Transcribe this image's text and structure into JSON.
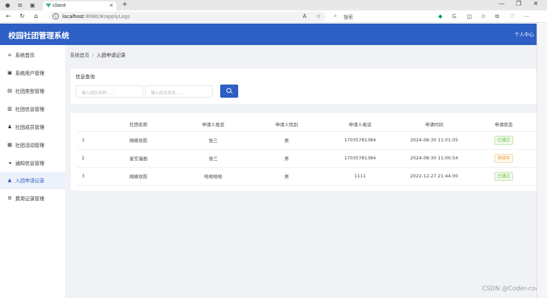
{
  "browser": {
    "tab_title": "client",
    "tab_close": "×",
    "new_tab": "+",
    "url_host": "localhost",
    "url_path": ":8080/#/applyLogs",
    "search_placeholder": "搜索",
    "win_min": "—",
    "win_max": "❐",
    "win_close": "✕"
  },
  "app": {
    "title": "校园社团管理系统",
    "user_menu": "个人中心"
  },
  "sidebar": {
    "items": [
      {
        "label": "系统首页",
        "icon": "home-icon"
      },
      {
        "label": "系统用户管理",
        "icon": "user-admin-icon"
      },
      {
        "label": "社团类型管理",
        "icon": "type-icon"
      },
      {
        "label": "社团信息管理",
        "icon": "info-icon"
      },
      {
        "label": "社团成员管理",
        "icon": "members-icon"
      },
      {
        "label": "社团活动管理",
        "icon": "activity-icon"
      },
      {
        "label": "通知信息管理",
        "icon": "notice-icon"
      },
      {
        "label": "入团申请记录",
        "icon": "apply-icon"
      },
      {
        "label": "费用记录管理",
        "icon": "fee-icon"
      }
    ]
  },
  "breadcrumb": {
    "home": "系统首页",
    "separator": "/",
    "current": "入团申请记录"
  },
  "query": {
    "title": "信息查询",
    "club_placeholder": "输入团队名称……",
    "applicant_placeholder": "输入成员姓名……"
  },
  "table": {
    "headers": [
      "",
      "社团名称",
      "申请人姓名",
      "申请人性别",
      "申请人电话",
      "申请时间",
      "申请状态"
    ],
    "rows": [
      {
        "no": "1",
        "club": "网络攻防",
        "name": "张三",
        "gender": "男",
        "phone": "17035781384",
        "time": "2024-08-30 11:01:05",
        "status": "已通过",
        "status_type": "ok"
      },
      {
        "no": "2",
        "club": "星空漫画",
        "name": "张三",
        "gender": "男",
        "phone": "17035781384",
        "time": "2024-08-30 11:00:54",
        "status": "审核中",
        "status_type": "wait"
      },
      {
        "no": "3",
        "club": "网络攻防",
        "name": "哈哈哈哈",
        "gender": "男",
        "phone": "1111",
        "time": "2022-12-27 21:44:00",
        "status": "已通过",
        "status_type": "ok"
      }
    ]
  },
  "watermark": "CSDN @Coder-coco",
  "colors": {
    "primary": "#2d5fc4",
    "success": "#67c23a",
    "warning": "#e6a23c",
    "page_bg": "#f0f2f5"
  }
}
